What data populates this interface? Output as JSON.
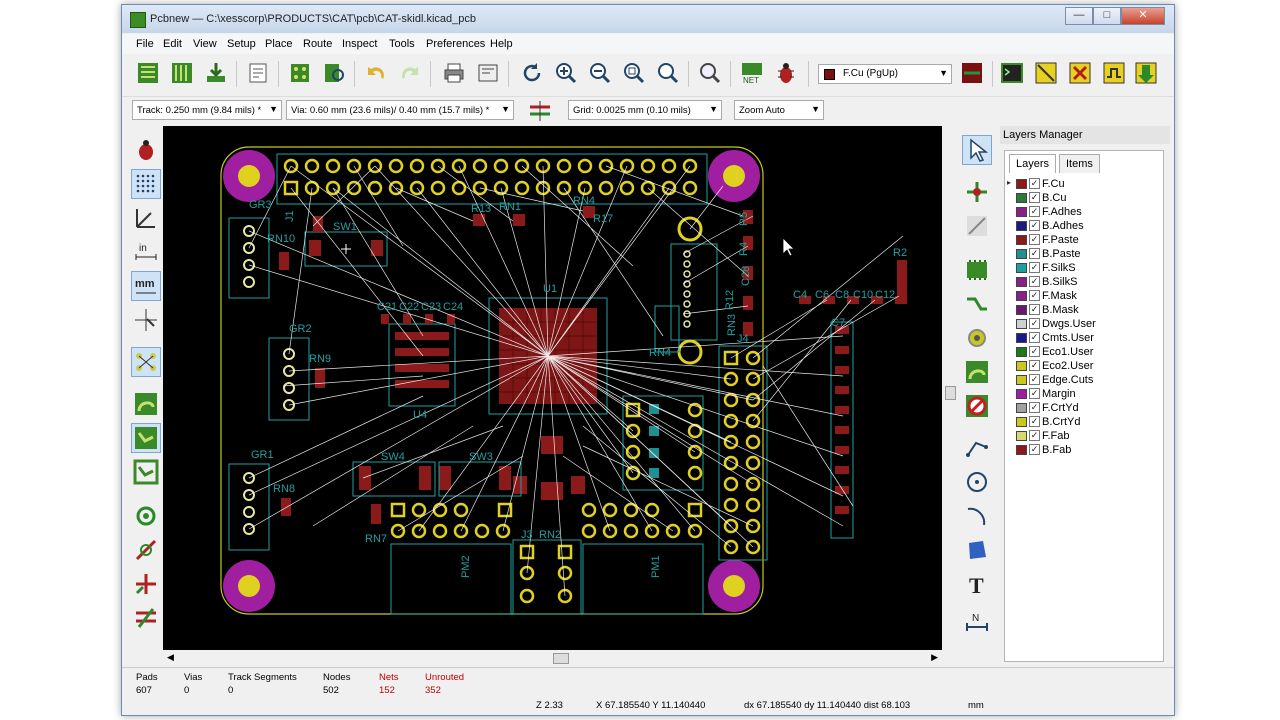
{
  "window": {
    "title": "Pcbnew — C:\\xesscorp\\PRODUCTS\\CAT\\pcb\\CAT-skidl.kicad_pcb",
    "controls": {
      "minimize": "—",
      "maximize": "□",
      "close": "✕"
    }
  },
  "menu": {
    "items": [
      {
        "label": "File"
      },
      {
        "label": "Edit"
      },
      {
        "label": "View"
      },
      {
        "label": "Setup"
      },
      {
        "label": "Place"
      },
      {
        "label": "Route"
      },
      {
        "label": "Inspect"
      },
      {
        "label": "Tools"
      },
      {
        "label": "Preferences"
      },
      {
        "label": "Help"
      }
    ]
  },
  "toolbar": {
    "active_layer": "F.Cu (PgUp)",
    "active_layer_color": "#7a1010"
  },
  "options": {
    "track": "Track: 0.250 mm (9.84 mils) *",
    "via": "Via: 0.60 mm (23.6 mils)/ 0.40 mm (15.7 mils) *",
    "grid": "Grid: 0.0025 mm (0.10 mils)",
    "zoom": "Zoom Auto"
  },
  "board_labels": {
    "gr3": "GR3",
    "j1": "J1",
    "r3": "R3",
    "sw1": "SW1",
    "rn10": "RN10",
    "r13": "R13",
    "rn1": "RN1",
    "rn4": "RN4",
    "r17": "R17",
    "r5": "R5",
    "r4": "R4",
    "c28": "C28",
    "r12": "R12",
    "rn3": "RN3",
    "j4": "J4",
    "rn4b": "RN4",
    "u1": "U1",
    "gr2": "GR2",
    "rn9": "RN9",
    "c21": "C21",
    "c22": "C22",
    "c23": "C23",
    "c24": "C24",
    "u4": "U4",
    "gr1": "GR1",
    "rn8": "RN8",
    "sw4": "SW4",
    "sw3": "SW3",
    "rn7": "RN7",
    "j3": "J3",
    "rn2": "RN2",
    "pm2": "PM2",
    "pm1": "PM1",
    "r2": "R2",
    "c4": "C4",
    "c6": "C6",
    "c8": "C8",
    "c10": "C10",
    "c12": "C12",
    "c7": "C7"
  },
  "layers_manager": {
    "title": "Layers Manager",
    "tabs": [
      "Layers",
      "Items"
    ],
    "layers": [
      {
        "name": "F.Cu",
        "color": "#8b1a1a",
        "checked": true,
        "current": true
      },
      {
        "name": "B.Cu",
        "color": "#2a7a3a",
        "checked": true
      },
      {
        "name": "F.Adhes",
        "color": "#8a1f8a",
        "checked": true
      },
      {
        "name": "B.Adhes",
        "color": "#1a1a7a",
        "checked": true
      },
      {
        "name": "F.Paste",
        "color": "#8b1a1a",
        "checked": true
      },
      {
        "name": "B.Paste",
        "color": "#1f8f8f",
        "checked": true
      },
      {
        "name": "F.SilkS",
        "color": "#1fa0a0",
        "checked": true
      },
      {
        "name": "B.SilkS",
        "color": "#8a1f8a",
        "checked": true
      },
      {
        "name": "F.Mask",
        "color": "#8a1f8a",
        "checked": true
      },
      {
        "name": "B.Mask",
        "color": "#6a1a6a",
        "checked": true
      },
      {
        "name": "Dwgs.User",
        "color": "#d0d0d0",
        "checked": true
      },
      {
        "name": "Cmts.User",
        "color": "#1a1a8a",
        "checked": true
      },
      {
        "name": "Eco1.User",
        "color": "#1a7a1a",
        "checked": true
      },
      {
        "name": "Eco2.User",
        "color": "#c8c820",
        "checked": true
      },
      {
        "name": "Edge.Cuts",
        "color": "#c8c820",
        "checked": true
      },
      {
        "name": "Margin",
        "color": "#a01fa0",
        "checked": true
      },
      {
        "name": "F.CrtYd",
        "color": "#a0a0a0",
        "checked": true
      },
      {
        "name": "B.CrtYd",
        "color": "#c8c820",
        "checked": true
      },
      {
        "name": "F.Fab",
        "color": "#d8d870",
        "checked": true
      },
      {
        "name": "B.Fab",
        "color": "#8b1a1a",
        "checked": true
      }
    ]
  },
  "status": {
    "pads_label": "Pads",
    "pads": "607",
    "vias_label": "Vias",
    "vias": "0",
    "tracks_label": "Track Segments",
    "tracks": "0",
    "nodes_label": "Nodes",
    "nodes": "502",
    "nets_label": "Nets",
    "nets": "152",
    "unrouted_label": "Unrouted",
    "unrouted": "352",
    "zoom": "Z 2.33",
    "xy": "X 67.185540  Y 11.140440",
    "dxy": "dx 67.185540  dy 11.140440   dist 68.103",
    "units": "mm"
  }
}
